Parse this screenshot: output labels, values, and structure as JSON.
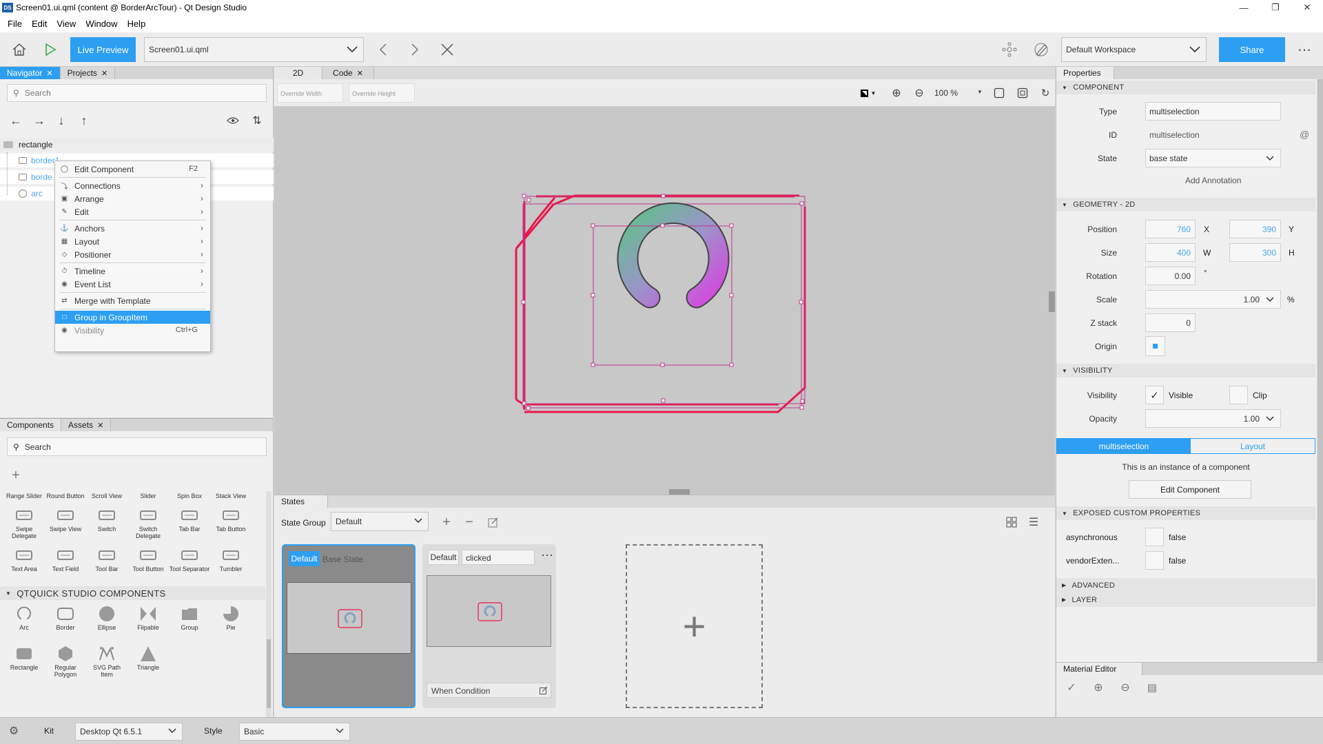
{
  "window": {
    "title": "Screen01.ui.qml (content @ BorderArcTour) - Qt Design Studio",
    "app_icon": "DS"
  },
  "menu": [
    "File",
    "Edit",
    "View",
    "Window",
    "Help"
  ],
  "toolbar": {
    "live_preview": "Live Preview",
    "file": "Screen01.ui.qml",
    "workspace": "Default Workspace",
    "share": "Share"
  },
  "navigator": {
    "tabs": [
      "Navigator",
      "Projects"
    ],
    "search_placeholder": "Search",
    "root": "rectangle",
    "items": [
      "border1",
      "borde",
      "arc"
    ]
  },
  "context_menu": {
    "items": [
      {
        "label": "Edit Component",
        "shortcut": "F2",
        "submenu": false,
        "icon": "component-icon"
      },
      {
        "sep": true
      },
      {
        "label": "Connections",
        "submenu": true,
        "icon": "connections-icon"
      },
      {
        "label": "Arrange",
        "submenu": true,
        "icon": "arrange-icon"
      },
      {
        "label": "Edit",
        "submenu": true,
        "icon": "edit-icon"
      },
      {
        "sep": true
      },
      {
        "label": "Anchors",
        "submenu": true,
        "icon": "anchors-icon"
      },
      {
        "label": "Layout",
        "submenu": true,
        "icon": "layout-icon"
      },
      {
        "label": "Positioner",
        "submenu": true,
        "icon": "positioner-icon"
      },
      {
        "sep": true
      },
      {
        "label": "Timeline",
        "submenu": true,
        "icon": "timeline-icon"
      },
      {
        "label": "Event List",
        "submenu": true,
        "icon": "event-list-icon"
      },
      {
        "sep": true
      },
      {
        "label": "Merge with Template",
        "submenu": false,
        "icon": "merge-icon"
      },
      {
        "sep": true
      },
      {
        "label": "Group in GroupItem",
        "submenu": false,
        "icon": "group-icon",
        "highlight": true
      },
      {
        "label": "Visibility",
        "shortcut": "Ctrl+G",
        "submenu": false,
        "icon": "visibility-icon",
        "disabled": true
      }
    ]
  },
  "components": {
    "tabs": [
      "Components",
      "Assets"
    ],
    "search_placeholder": "Search",
    "row1": [
      "Range Slider",
      "Round Button",
      "Scroll View",
      "Slider",
      "Spin Box",
      "Stack View"
    ],
    "row2": [
      "Swipe Delegate",
      "Swipe View",
      "Switch",
      "Switch Delegate",
      "Tab Bar",
      "Tab Button"
    ],
    "row3": [
      "Text Area",
      "Text Field",
      "Tool Bar",
      "Tool Button",
      "Tool Separator",
      "Tumbler"
    ],
    "section": "QTQUICK STUDIO COMPONENTS",
    "studio1": [
      "Arc",
      "Border",
      "Ellipse",
      "Flipable",
      "Group",
      "Pie"
    ],
    "studio2": [
      "Rectangle",
      "Regular Polygon",
      "SVG Path Item",
      "Triangle"
    ]
  },
  "editor": {
    "tabs": [
      "2D",
      "Code"
    ],
    "override_width": "Override Width",
    "override_height": "Override Height",
    "zoom": "100 %"
  },
  "states": {
    "tab": "States",
    "group_label": "State Group",
    "group_value": "Default",
    "base": {
      "badge": "Default",
      "name": "Base State"
    },
    "clicked": {
      "badge": "Default",
      "name": "clicked",
      "when": "When Condition"
    }
  },
  "properties": {
    "tab": "Properties",
    "component_section": "COMPONENT",
    "type_label": "Type",
    "type_value": "multiselection",
    "id_label": "ID",
    "id_value": "multiselection",
    "state_label": "State",
    "state_value": "base state",
    "add_annotation": "Add Annotation",
    "geometry_section": "GEOMETRY - 2D",
    "position_label": "Position",
    "x": "760",
    "x_label": "X",
    "y": "390",
    "y_label": "Y",
    "size_label": "Size",
    "w": "400",
    "w_label": "W",
    "h": "300",
    "h_label": "H",
    "rotation_label": "Rotation",
    "rotation": "0.00",
    "rotation_unit": "°",
    "scale_label": "Scale",
    "scale": "1.00",
    "scale_unit": "%",
    "z_label": "Z stack",
    "z": "0",
    "origin_label": "Origin",
    "visibility_section": "VISIBILITY",
    "visibility_label": "Visibility",
    "visible": "Visible",
    "clip": "Clip",
    "opacity_label": "Opacity",
    "opacity": "1.00",
    "subtabs": [
      "multiselection",
      "Layout"
    ],
    "instance_text": "This is an instance of a component",
    "edit_component": "Edit Component",
    "exposed_section": "EXPOSED CUSTOM PROPERTIES",
    "exposed": [
      {
        "name": "asynchronous",
        "value": "false"
      },
      {
        "name": "vendorExten...",
        "value": "false"
      }
    ],
    "advanced_section": "ADVANCED",
    "layer_section": "LAYER"
  },
  "material_editor": {
    "tab": "Material Editor"
  },
  "statusbar": {
    "kit_label": "Kit",
    "kit_value": "Desktop Qt 6.5.1",
    "style_label": "Style",
    "style_value": "Basic"
  },
  "colors": {
    "accent": "#2d9ff2",
    "selection": "#e8174a",
    "handles": "#c1368e"
  }
}
